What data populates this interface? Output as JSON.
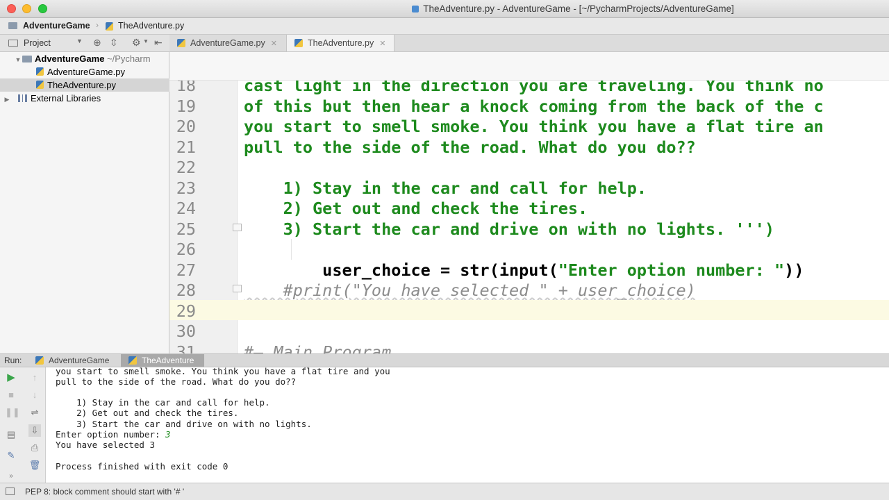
{
  "window": {
    "title": "TheAdventure.py - AdventureGame - [~/PycharmProjects/AdventureGame]"
  },
  "breadcrumb": {
    "project": "AdventureGame",
    "file": "TheAdventure.py"
  },
  "project_panel": {
    "label": "Project",
    "tree": [
      {
        "label": "AdventureGame",
        "suffix": "~/Pycharm",
        "type": "folder",
        "expanded": true
      },
      {
        "label": "AdventureGame.py",
        "type": "file"
      },
      {
        "label": "TheAdventure.py",
        "type": "file",
        "selected": true
      },
      {
        "label": "External Libraries",
        "type": "library",
        "expanded": false
      }
    ]
  },
  "editor": {
    "tabs": [
      {
        "label": "AdventureGame.py",
        "active": false
      },
      {
        "label": "TheAdventure.py",
        "active": true
      }
    ],
    "lines": [
      {
        "num": "18",
        "text": "cast light in the direction you are traveling. You think no"
      },
      {
        "num": "19",
        "text": "of this but then hear a knock coming from the back of the c"
      },
      {
        "num": "20",
        "text": "you start to smell smoke. You think you have a flat tire an"
      },
      {
        "num": "21",
        "text": "pull to the side of the road. What do you do??"
      },
      {
        "num": "22",
        "text": ""
      },
      {
        "num": "23",
        "text": "    1) Stay in the car and call for help."
      },
      {
        "num": "24",
        "text": "    2) Get out and check the tires."
      },
      {
        "num": "25",
        "text": "    3) Start the car and drive on with no lights. ''')"
      },
      {
        "num": "26",
        "text": ""
      },
      {
        "num": "27",
        "text_a": "        user_choice = str(input(",
        "text_b": "\"Enter option number: \"",
        "text_c": "))"
      },
      {
        "num": "28",
        "text": "    #print(\"You have selected \" + user_choice)"
      },
      {
        "num": "29",
        "text": ""
      },
      {
        "num": "30",
        "text": ""
      },
      {
        "num": "31",
        "text": "#— Main Program"
      }
    ]
  },
  "run_panel": {
    "label": "Run:",
    "tabs": [
      {
        "label": "AdventureGame",
        "active": false
      },
      {
        "label": "TheAdventure",
        "active": true
      }
    ],
    "output": [
      "you start to smell smoke. You think you have a flat tire and you",
      "pull to the side of the road. What do you do??",
      "",
      "    1) Stay in the car and call for help.",
      "    2) Get out and check the tires.",
      "    3) Start the car and drive on with no lights.",
      "",
      "You have selected 3",
      "",
      "Process finished with exit code 0"
    ],
    "prompt_label": "Enter option number: ",
    "prompt_value": "3"
  },
  "statusbar": {
    "message": "PEP 8: block comment should start with '# '"
  },
  "colors": {
    "string": "#1d8a1d",
    "comment": "#8c8c8c",
    "current_line": "#fcfae3"
  }
}
